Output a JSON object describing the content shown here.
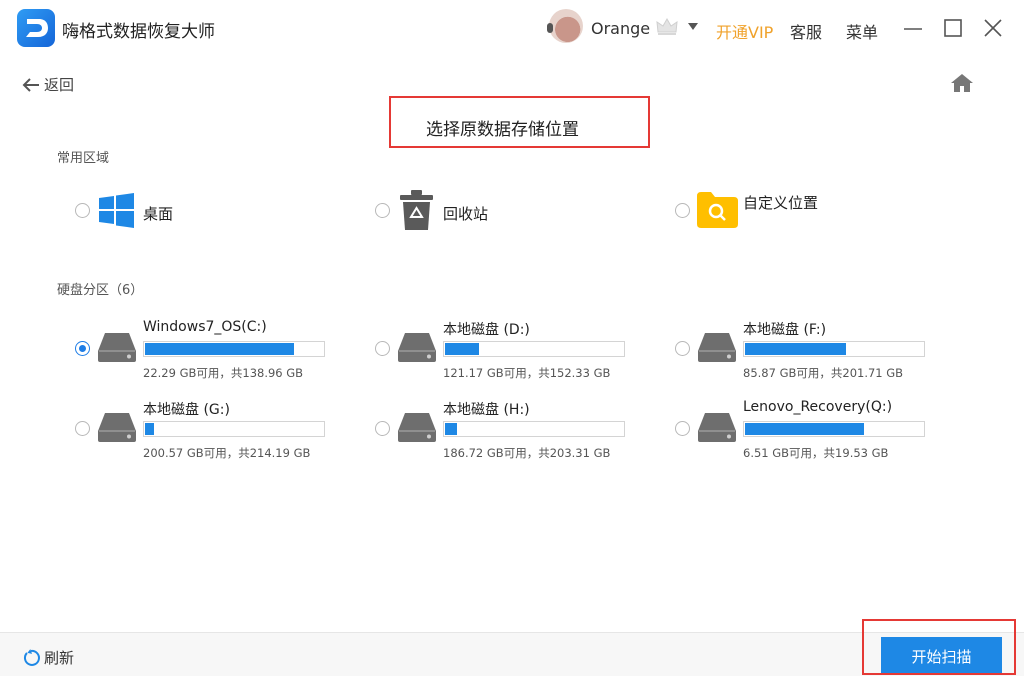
{
  "app": {
    "title": "嗨格式数据恢复大师"
  },
  "user": {
    "name": "Orange",
    "vip_label": "开通VIP",
    "service_label": "客服",
    "menu_label": "菜单"
  },
  "nav": {
    "back_label": "返回"
  },
  "page": {
    "title": "选择原数据存储位置"
  },
  "common_area": {
    "label": "常用区域",
    "items": [
      {
        "label": "桌面",
        "icon": "windows-icon",
        "selected": false
      },
      {
        "label": "回收站",
        "icon": "recycle-bin-icon",
        "selected": false
      },
      {
        "label": "自定义位置",
        "icon": "folder-search-icon",
        "selected": false
      }
    ]
  },
  "drives": {
    "label": "硬盘分区（6）",
    "items": [
      {
        "name": "Windows7_OS(C:)",
        "info": "22.29 GB可用，共138.96 GB",
        "used_fraction": 0.84,
        "selected": true
      },
      {
        "name": "本地磁盘 (D:)",
        "info": "121.17 GB可用，共152.33 GB",
        "used_fraction": 0.2,
        "selected": false
      },
      {
        "name": "本地磁盘 (F:)",
        "info": "85.87 GB可用，共201.71 GB",
        "used_fraction": 0.57,
        "selected": false
      },
      {
        "name": "本地磁盘 (G:)",
        "info": "200.57 GB可用，共214.19 GB",
        "used_fraction": 0.06,
        "selected": false
      },
      {
        "name": "本地磁盘 (H:)",
        "info": "186.72 GB可用，共203.31 GB",
        "used_fraction": 0.08,
        "selected": false
      },
      {
        "name": "Lenovo_Recovery(Q:)",
        "info": "6.51 GB可用，共19.53 GB",
        "used_fraction": 0.67,
        "selected": false
      }
    ]
  },
  "footer": {
    "refresh_label": "刷新",
    "scan_label": "开始扫描"
  },
  "colors": {
    "accent": "#1e88e5",
    "vip": "#f0a22b",
    "highlight": "#e53935"
  }
}
